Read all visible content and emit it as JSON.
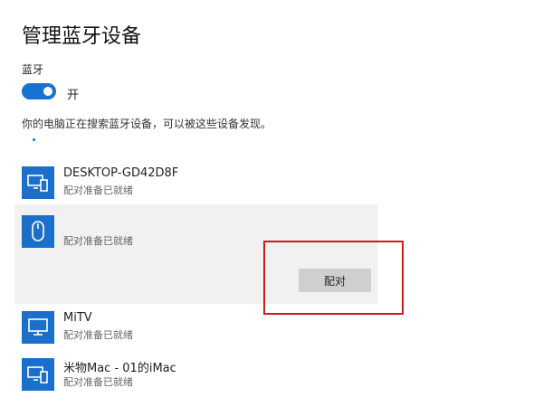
{
  "page": {
    "title": "管理蓝牙设备"
  },
  "bluetooth": {
    "label": "蓝牙",
    "toggle_state": "开",
    "toggle_on": true,
    "status_text": "你的电脑正在搜索蓝牙设备，可以被这些设备发现。"
  },
  "devices": [
    {
      "name": "DESKTOP-GD42D8F",
      "status": "配对准备已就绪",
      "icon": "computer-icon"
    },
    {
      "name": "",
      "status": "配对准备已就绪",
      "icon": "mouse-icon",
      "selected": true
    },
    {
      "name": "MiTV",
      "status": "配对准备已就绪",
      "icon": "monitor-icon"
    },
    {
      "name": "米物Mac - 01的iMac",
      "status": "配对准备已就绪",
      "icon": "computer-icon"
    }
  ],
  "actions": {
    "pair_label": "配对"
  },
  "colors": {
    "accent": "#1773d1",
    "icon_bg": "#1b6fc8",
    "selected_bg": "#f1f1f1",
    "highlight": "#d11a1a"
  }
}
